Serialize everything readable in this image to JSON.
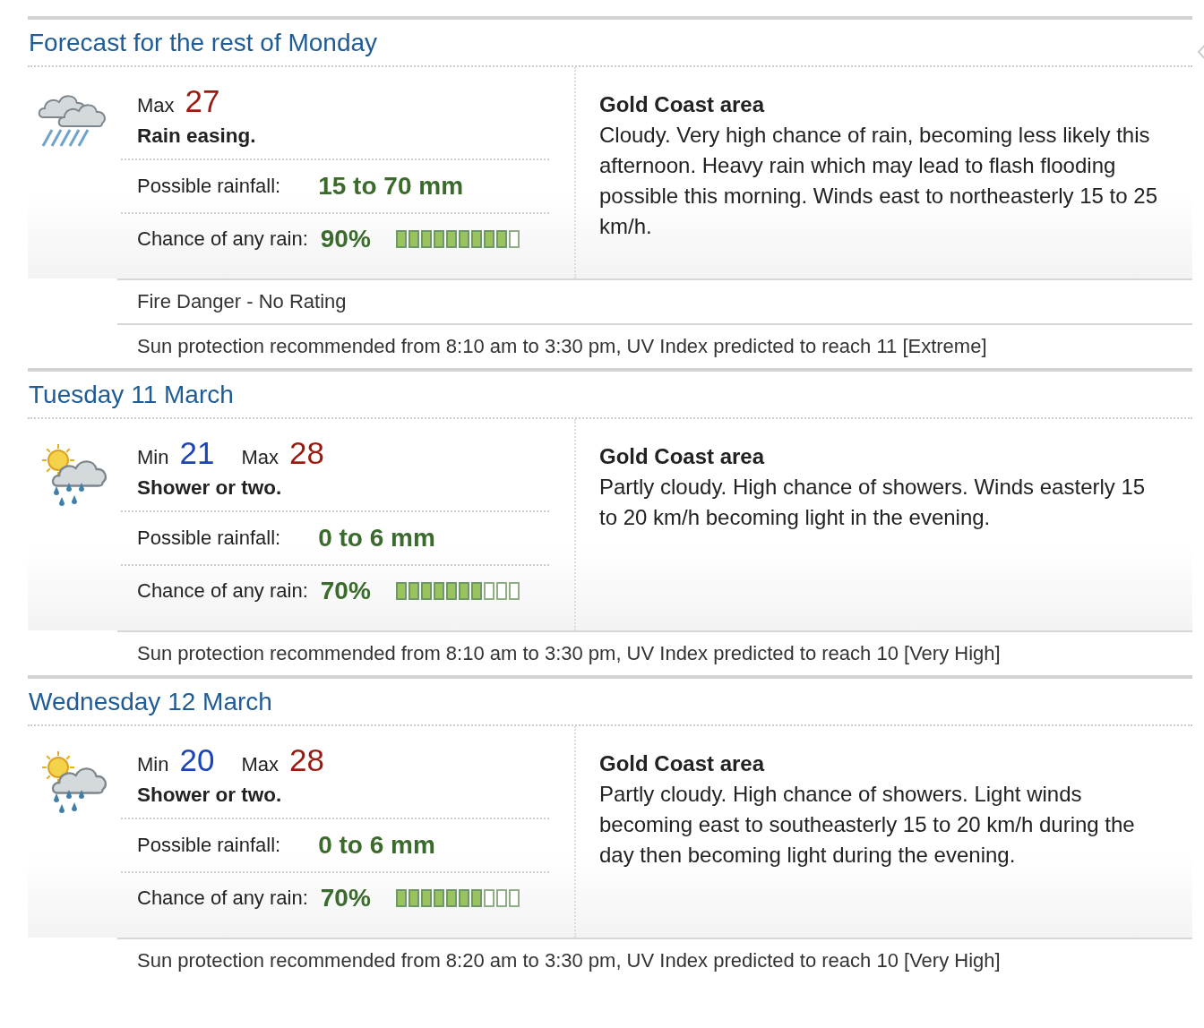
{
  "sections": [
    {
      "title": "Forecast for the rest of Monday",
      "kind": "rain",
      "temps": [
        {
          "kind": "max",
          "label": "Max",
          "value": "27"
        }
      ],
      "summary": "Rain easing.",
      "rainfall": {
        "label": "Possible rainfall:",
        "value": "15 to 70 mm"
      },
      "chance": {
        "label": "Chance of any rain:",
        "value": "90%",
        "level": 0.9
      },
      "area": "Gold Coast area",
      "description": "Cloudy. Very high chance of rain, becoming less likely this afternoon. Heavy rain which may lead to flash flooding possible this morning. Winds east to northeasterly 15 to 25 km/h.",
      "notes": [
        "Fire Danger - No Rating",
        "Sun protection recommended from 8:10 am to 3:30 pm, UV Index predicted to reach 11 [Extreme]"
      ]
    },
    {
      "title": "Tuesday 11 March",
      "kind": "shower",
      "temps": [
        {
          "kind": "min",
          "label": "Min",
          "value": "21"
        },
        {
          "kind": "max",
          "label": "Max",
          "value": "28"
        }
      ],
      "summary": "Shower or two.",
      "rainfall": {
        "label": "Possible rainfall:",
        "value": "0 to 6 mm"
      },
      "chance": {
        "label": "Chance of any rain:",
        "value": "70%",
        "level": 0.7
      },
      "area": "Gold Coast area",
      "description": "Partly cloudy. High chance of showers. Winds easterly 15 to 20 km/h becoming light in the evening.",
      "notes": [
        "Sun protection recommended from 8:10 am to 3:30 pm, UV Index predicted to reach 10 [Very High]"
      ]
    },
    {
      "title": "Wednesday 12 March",
      "kind": "shower",
      "temps": [
        {
          "kind": "min",
          "label": "Min",
          "value": "20"
        },
        {
          "kind": "max",
          "label": "Max",
          "value": "28"
        }
      ],
      "summary": "Shower or two.",
      "rainfall": {
        "label": "Possible rainfall:",
        "value": "0 to 6 mm"
      },
      "chance": {
        "label": "Chance of any rain:",
        "value": "70%",
        "level": 0.7
      },
      "area": "Gold Coast area",
      "description": "Partly cloudy. High chance of showers. Light winds becoming east to southeasterly 15 to 20 km/h during the day then becoming light during the evening.",
      "notes": [
        "Sun protection recommended from 8:20 am to 3:30 pm, UV Index predicted to reach 10 [Very High]"
      ]
    }
  ]
}
